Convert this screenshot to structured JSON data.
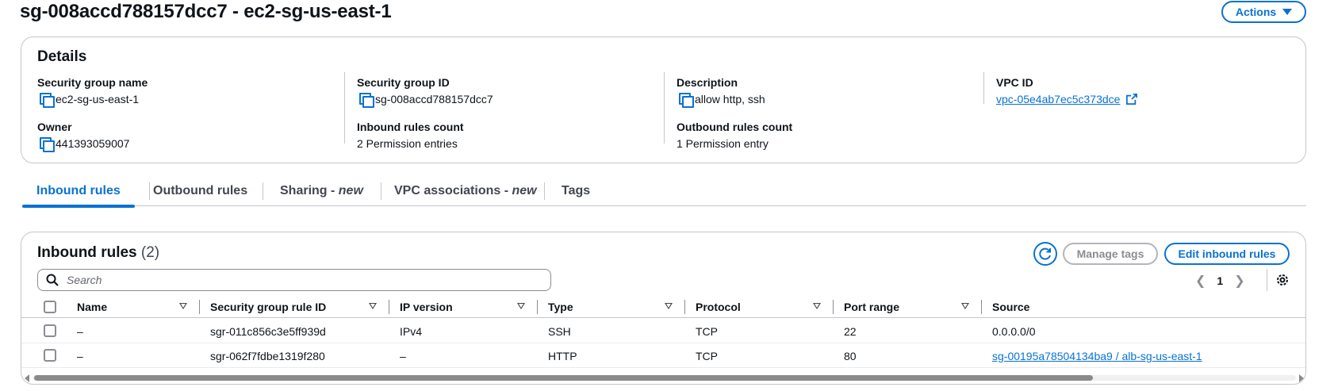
{
  "header": {
    "title": "sg-008accd788157dcc7 - ec2-sg-us-east-1",
    "actions_label": "Actions"
  },
  "details": {
    "title": "Details",
    "fields": {
      "sg_name": {
        "label": "Security group name",
        "value": "ec2-sg-us-east-1"
      },
      "sg_id": {
        "label": "Security group ID",
        "value": "sg-008accd788157dcc7"
      },
      "description": {
        "label": "Description",
        "value": "allow http, ssh"
      },
      "vpc_id": {
        "label": "VPC ID",
        "value": "vpc-05e4ab7ec5c373dce"
      },
      "owner": {
        "label": "Owner",
        "value": "441393059007"
      },
      "inbound_count": {
        "label": "Inbound rules count",
        "value": "2 Permission entries"
      },
      "outbound_count": {
        "label": "Outbound rules count",
        "value": "1 Permission entry"
      }
    }
  },
  "tabs": [
    {
      "label": "Inbound rules",
      "suffix": "",
      "active": true
    },
    {
      "label": "Outbound rules",
      "suffix": ""
    },
    {
      "label": "Sharing - ",
      "suffix": "new"
    },
    {
      "label": "VPC associations - ",
      "suffix": "new"
    },
    {
      "label": "Tags",
      "suffix": ""
    }
  ],
  "inbound": {
    "title": "Inbound rules",
    "count": "(2)",
    "manage_tags_label": "Manage tags",
    "edit_label": "Edit inbound rules",
    "search_placeholder": "Search",
    "page": "1",
    "columns": [
      "Name",
      "Security group rule ID",
      "IP version",
      "Type",
      "Protocol",
      "Port range",
      "Source"
    ],
    "rows": [
      {
        "name": "–",
        "rule_id": "sgr-011c856c3e5ff939d",
        "ip_version": "IPv4",
        "type": "SSH",
        "protocol": "TCP",
        "port_range": "22",
        "source": "0.0.0.0/0"
      },
      {
        "name": "–",
        "rule_id": "sgr-062f7fdbe1319f280",
        "ip_version": "–",
        "type": "HTTP",
        "protocol": "TCP",
        "port_range": "80",
        "source": "sg-00195a78504134ba9 / alb-sg-us-east-1"
      }
    ]
  },
  "colors": {
    "accent": "#0972d3",
    "border": "#c6c6cd",
    "text": "#0f141a",
    "disabled": "#8c8c94"
  }
}
